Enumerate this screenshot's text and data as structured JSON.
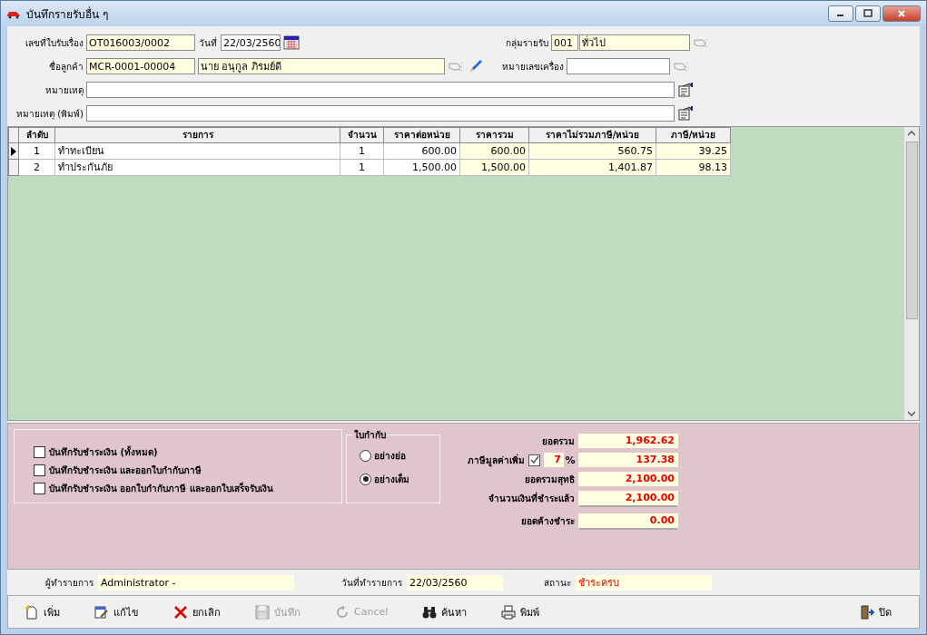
{
  "window": {
    "title": "บันทึกรายรับอื่น ๆ"
  },
  "header": {
    "receipt_no": {
      "label": "เลขที่ใบรับเรื่อง",
      "value": "OT016003/0002"
    },
    "date": {
      "label": "วันที่",
      "value": "22/03/2560"
    },
    "income_group": {
      "label": "กลุ่มรายรับ",
      "code": "001",
      "name": "ทั่วไป"
    },
    "customer": {
      "label": "ชื่อลูกค้า",
      "code": "MCR-0001-00004",
      "name": "นาย อนุกูล ภิรมย์ดี"
    },
    "machine_no": {
      "label": "หมายเลขเครื่อง"
    },
    "note": {
      "label": "หมายเหตุ"
    },
    "note_print": {
      "label": "หมายเหตุ (พิมพ์)"
    }
  },
  "table": {
    "columns": [
      {
        "label": "ลำดับ",
        "shaded": false
      },
      {
        "label": "รายการ",
        "shaded": false
      },
      {
        "label": "จำนวน",
        "shaded": false
      },
      {
        "label": "ราคาต่อหน่วย",
        "shaded": false
      },
      {
        "label": "ราคารวม",
        "shaded": true
      },
      {
        "label": "ราคาไม่รวมภาษี/หน่วย",
        "shaded": true
      },
      {
        "label": "ภาษี/หน่วย",
        "shaded": true
      }
    ],
    "rows": [
      {
        "current": true,
        "cells": [
          "1",
          "ทำทะเบียน",
          "1",
          "600.00",
          "600.00",
          "560.75",
          "39.25"
        ]
      },
      {
        "current": false,
        "cells": [
          "2",
          "ทำประกันภัย",
          "1",
          "1,500.00",
          "1,500.00",
          "1,401.87",
          "98.13"
        ]
      }
    ]
  },
  "options": {
    "checkboxes": [
      {
        "label": "บันทึกรับชำระเงิน (ทั้งหมด)",
        "checked": false
      },
      {
        "label": "บันทึกรับชำระเงิน และออกใบกำกับภาษี",
        "checked": false
      },
      {
        "label": "บันทึกรับชำระเงิน ออกใบกำกับภาษี และออกใบเสร็จรับเงิน",
        "checked": false
      }
    ],
    "invoice_type": {
      "title": "ใบกำกับ",
      "options": [
        {
          "label": "อย่างย่อ",
          "selected": false
        },
        {
          "label": "อย่างเต็ม",
          "selected": true
        }
      ]
    }
  },
  "totals": [
    {
      "kind": "amount",
      "label": "ยอดรวม",
      "value": "1,962.62"
    },
    {
      "kind": "vat",
      "label": "ภาษีมูลค่าเพิ่ม",
      "checked": true,
      "rate": "7",
      "unit": "%",
      "value": "137.38"
    },
    {
      "kind": "amount",
      "label": "ยอดรวมสุทธิ",
      "value": "2,100.00"
    },
    {
      "kind": "amount",
      "label": "จำนวนเงินที่ชำระแล้ว",
      "value": "2,100.00"
    },
    {
      "kind": "amount",
      "label": "ยอดค้างชำระ",
      "value": "0.00"
    }
  ],
  "status": {
    "operator": {
      "label": "ผู้ทำรายการ",
      "value": "Administrator -"
    },
    "date": {
      "label": "วันที่ทำรายการ",
      "value": "22/03/2560"
    },
    "state": {
      "label": "สถานะ",
      "value": "ชำระครบ"
    }
  },
  "toolbar": [
    {
      "kind": "add",
      "label": "เพิ่ม",
      "disabled": false
    },
    {
      "kind": "edit",
      "label": "แก้ไข",
      "disabled": false
    },
    {
      "kind": "void",
      "label": "ยกเลิก",
      "disabled": false
    },
    {
      "kind": "save",
      "label": "บันทึก",
      "disabled": true
    },
    {
      "kind": "cancel",
      "label": "Cancel",
      "disabled": true
    },
    {
      "kind": "search",
      "label": "ค้นหา",
      "disabled": false
    },
    {
      "kind": "print",
      "label": "พิมพ์",
      "disabled": false
    },
    {
      "kind": "close",
      "label": "ปิด",
      "disabled": false
    }
  ]
}
